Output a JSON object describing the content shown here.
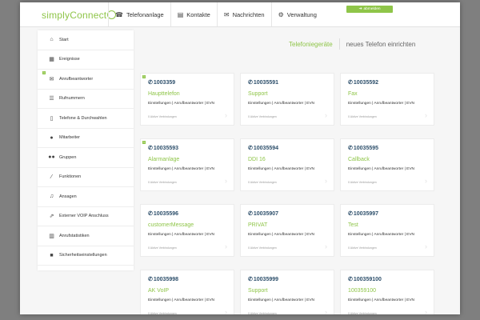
{
  "app": {
    "logo_text": "simplyConnect"
  },
  "nav": [
    {
      "label": "Telefonanlage",
      "icon": "phone-box-icon"
    },
    {
      "label": "Kontakte",
      "icon": "book-icon"
    },
    {
      "label": "Nachrichten",
      "icon": "envelope-icon"
    },
    {
      "label": "Verwaltung",
      "icon": "gears-icon"
    }
  ],
  "logout_label": "abmelden",
  "sidebar": [
    {
      "label": "Start",
      "icon": "home-icon",
      "badge": ""
    },
    {
      "label": "Ereignisse",
      "icon": "calendar-icon",
      "badge": ""
    },
    {
      "label": "Anrufbeantworter",
      "icon": "voicemail-icon",
      "badge": "1"
    },
    {
      "label": "Rufnummern",
      "icon": "list-icon",
      "badge": ""
    },
    {
      "label": "Telefone & Durchwahlen",
      "icon": "device-icon",
      "badge": ""
    },
    {
      "label": "Mitarbeiter",
      "icon": "user-icon",
      "badge": ""
    },
    {
      "label": "Gruppen",
      "icon": "users-icon",
      "badge": ""
    },
    {
      "label": "Funktionen",
      "icon": "wand-icon",
      "badge": ""
    },
    {
      "label": "Ansagen",
      "icon": "music-icon",
      "badge": ""
    },
    {
      "label": "Externer VOIP Anschluss",
      "icon": "external-link-icon",
      "badge": ""
    },
    {
      "label": "Anrufstatistiken",
      "icon": "bar-chart-icon",
      "badge": ""
    },
    {
      "label": "Sicherheitseinstellungen",
      "icon": "lock-icon",
      "badge": ""
    }
  ],
  "tabs": {
    "active": "Telefoniegeräte",
    "other": "neues Telefon einrichten"
  },
  "cards": [
    {
      "number": "1003359",
      "name": "Haupttelefon",
      "badge": "1"
    },
    {
      "number": "10035591",
      "name": "Support",
      "badge": ""
    },
    {
      "number": "10035592",
      "name": "Fax",
      "badge": ""
    },
    {
      "number": "10035593",
      "name": "Alarmanlage",
      "badge": "1"
    },
    {
      "number": "10035594",
      "name": "DDI 16",
      "badge": ""
    },
    {
      "number": "10035595",
      "name": "Callback",
      "badge": ""
    },
    {
      "number": "10035596",
      "name": "customerMessage",
      "badge": ""
    },
    {
      "number": "10035907",
      "name": "PRIVAT",
      "badge": ""
    },
    {
      "number": "10035997",
      "name": "Test",
      "badge": ""
    },
    {
      "number": "10035998",
      "name": "AK VoIP",
      "badge": ""
    },
    {
      "number": "10035999",
      "name": "Support",
      "badge": ""
    },
    {
      "number": "100359100",
      "name": "100359100",
      "badge": ""
    }
  ],
  "card_links_text": "Einstellungen | Anrufbeantworter | EVN",
  "card_status_text": "0 Aktive Verbindungen"
}
